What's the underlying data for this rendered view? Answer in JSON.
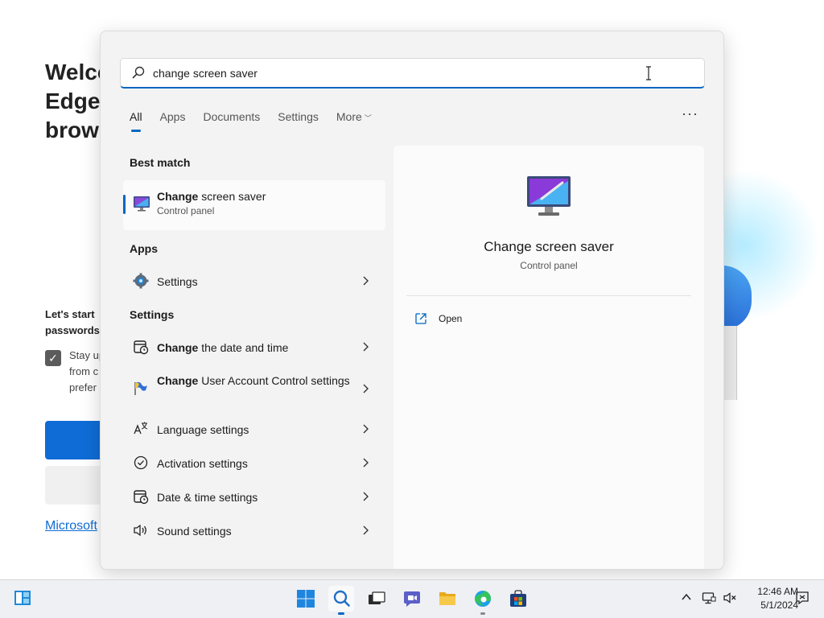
{
  "background_page": {
    "title": "Welcome to Microsoft\nEdge, the\nbrowser",
    "lets_start": "Let's start\npasswords",
    "stay_text": "Stay up\nfrom c\nprefer",
    "link_text": "Microsoft"
  },
  "search": {
    "query": "change screen saver",
    "tabs": [
      {
        "label": "All"
      },
      {
        "label": "Apps"
      },
      {
        "label": "Documents"
      },
      {
        "label": "Settings"
      },
      {
        "label": "More"
      }
    ],
    "more_options": "···"
  },
  "best_match": {
    "header": "Best match",
    "title_bold": "Change",
    "title_rest": " screen saver",
    "subtitle": "Control panel"
  },
  "apps": {
    "header": "Apps",
    "items": [
      {
        "label": "Settings"
      }
    ]
  },
  "settings": {
    "header": "Settings",
    "items": [
      {
        "bold": "Change",
        "rest": " the date and time"
      },
      {
        "bold": "Change",
        "rest": " User Account Control settings"
      },
      {
        "bold": "",
        "rest": "Language settings"
      },
      {
        "bold": "",
        "rest": "Activation settings"
      },
      {
        "bold": "",
        "rest": "Date & time settings"
      },
      {
        "bold": "",
        "rest": "Sound settings"
      }
    ]
  },
  "preview": {
    "title": "Change screen saver",
    "subtitle": "Control panel",
    "actions": [
      {
        "label": "Open"
      }
    ]
  },
  "taskbar": {
    "clock_time": "12:46 AM",
    "clock_date": "5/1/2024"
  },
  "colors": {
    "accent": "#0067c0",
    "flyout_bg": "#f3f3f3",
    "taskbar_bg": "#eef0f4"
  }
}
